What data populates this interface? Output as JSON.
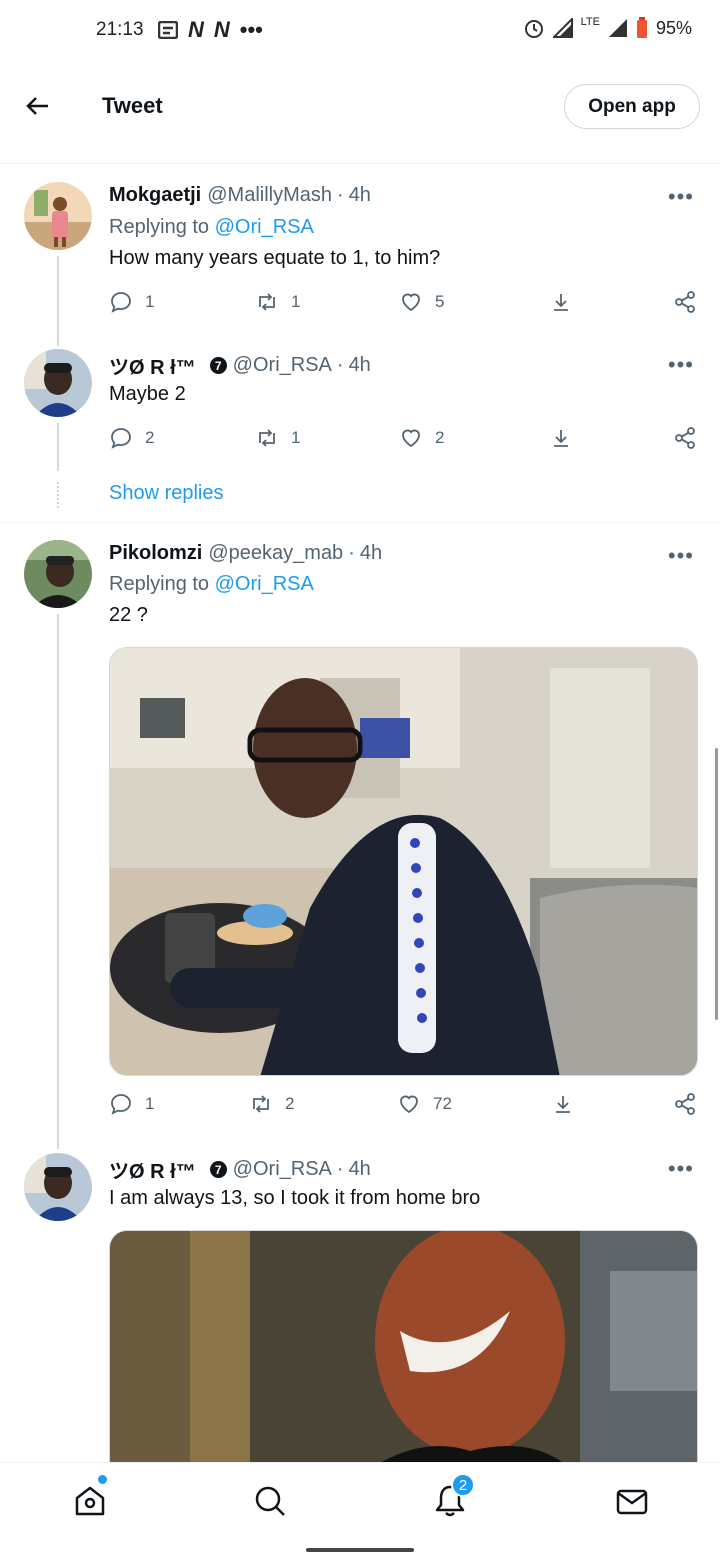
{
  "status_bar": {
    "time": "21:13",
    "notification_icons": [
      "message-icon",
      "N",
      "N",
      "•••"
    ],
    "network": "LTE",
    "battery": "95%"
  },
  "topbar": {
    "title": "Tweet",
    "open_app": "Open app"
  },
  "tweets": [
    {
      "name": "Mokgaetji",
      "handle": "@MalillyMash",
      "time": "4h",
      "replying_prefix": "Replying to ",
      "replying_to": "@Ori_RSA",
      "text": "How many years equate to 1, to him?",
      "replies": "1",
      "retweets": "1",
      "likes": "5"
    },
    {
      "name": "ツØ R ł™",
      "verified_badge": "7",
      "handle": "@Ori_RSA",
      "time": "4h",
      "text": "Maybe 2",
      "replies": "2",
      "retweets": "1",
      "likes": "2",
      "show_replies": "Show replies"
    },
    {
      "name": "Pikolomzi",
      "handle": "@peekay_mab",
      "time": "4h",
      "replying_prefix": "Replying to ",
      "replying_to": "@Ori_RSA",
      "text": "22 ?",
      "replies": "1",
      "retweets": "2",
      "likes": "72"
    },
    {
      "name": "ツØ R ł™",
      "verified_badge": "7",
      "handle": "@Ori_RSA",
      "time": "4h",
      "text": "I am always 13, so I took it from home bro"
    }
  ],
  "bottom_nav": {
    "items": [
      "home-icon",
      "search-icon",
      "bell-icon",
      "mail-icon"
    ],
    "notification_count": "2"
  },
  "colors": {
    "accent": "#1d9bf0",
    "text": "#0f1419",
    "secondary": "#536471"
  }
}
